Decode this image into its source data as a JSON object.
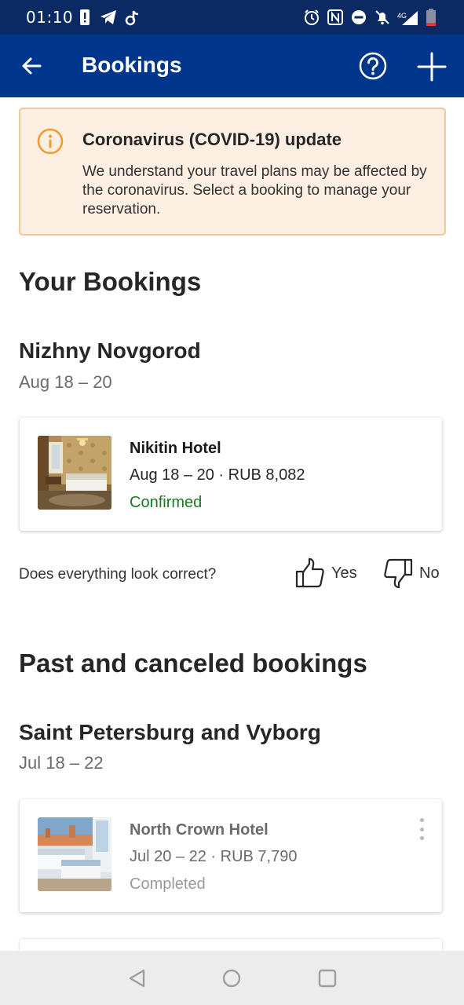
{
  "status_bar": {
    "time": "01:10",
    "network": "4G",
    "icons": [
      "alert-icon",
      "telegram-icon",
      "tiktok-icon",
      "alarm-icon",
      "nfc-icon",
      "dnd-icon",
      "bell-off-icon",
      "signal-icon",
      "battery-icon"
    ]
  },
  "app_bar": {
    "title": "Bookings",
    "back_icon": "arrow-left-icon",
    "help_icon": "question-circle-icon",
    "add_icon": "plus-icon"
  },
  "covid_banner": {
    "title": "Coronavirus (COVID-19) update",
    "text": "We understand your travel plans may be affected by the coronavirus. Select a booking to manage your reservation.",
    "icon": "info-circle-icon",
    "accent": "#f39a2e"
  },
  "your_bookings": {
    "heading": "Your Bookings",
    "trips": [
      {
        "city": "Nizhny Novgorod",
        "dates": "Aug 18 – 20",
        "bookings": [
          {
            "hotel": "Nikitin Hotel",
            "info": "Aug 18 – 20 · RUB 8,082",
            "status": "Confirmed",
            "status_color": "#1a7a1f"
          }
        ]
      }
    ]
  },
  "feedback": {
    "question": "Does everything look correct?",
    "yes_label": "Yes",
    "no_label": "No",
    "yes_icon": "thumbs-up-icon",
    "no_icon": "thumbs-down-icon"
  },
  "past_bookings": {
    "heading": "Past and canceled bookings",
    "trips": [
      {
        "city": "Saint Petersburg and Vyborg",
        "dates": "Jul 18 – 22",
        "bookings": [
          {
            "hotel": "North Crown Hotel",
            "info": "Jul 20 – 22 · RUB 7,790",
            "status": "Completed",
            "status_color": "#9a9a9a"
          }
        ]
      }
    ]
  },
  "nav_bar": {
    "buttons": [
      "back-triangle-icon",
      "home-circle-icon",
      "recents-square-icon"
    ]
  },
  "colors": {
    "app_bar": "#00368c",
    "status_bar": "#0b2a63",
    "banner_bg": "#fdf0e3",
    "banner_border": "#f3c997"
  }
}
